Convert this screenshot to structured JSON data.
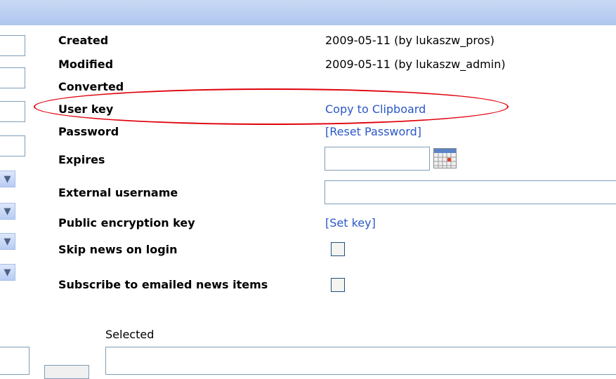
{
  "fields": {
    "created": {
      "label": "Created",
      "value": "2009-05-11 (by lukaszw_pros)"
    },
    "modified": {
      "label": "Modified",
      "value": "2009-05-11 (by lukaszw_admin)"
    },
    "converted": {
      "label": "Converted"
    },
    "user_key": {
      "label": "User key",
      "link": "Copy to Clipboard"
    },
    "password": {
      "label": "Password",
      "link": "[Reset Password]"
    },
    "expires": {
      "label": "Expires",
      "value": ""
    },
    "external_username": {
      "label": "External username",
      "value": ""
    },
    "public_encryption_key": {
      "label": "Public encryption key",
      "link": "[Set key]"
    },
    "skip_news": {
      "label": "Skip news on login",
      "checked": false
    },
    "subscribe_news": {
      "label": "Subscribe to emailed news items",
      "checked": false
    }
  },
  "selected": {
    "label": "Selected"
  },
  "icons": {
    "calendar": "calendar-icon",
    "dropdown": "chevron-down-icon"
  },
  "colors": {
    "header": "#aec6ee",
    "link": "#2a57c8",
    "highlight": "#e0000b",
    "border": "#7f9db9"
  }
}
